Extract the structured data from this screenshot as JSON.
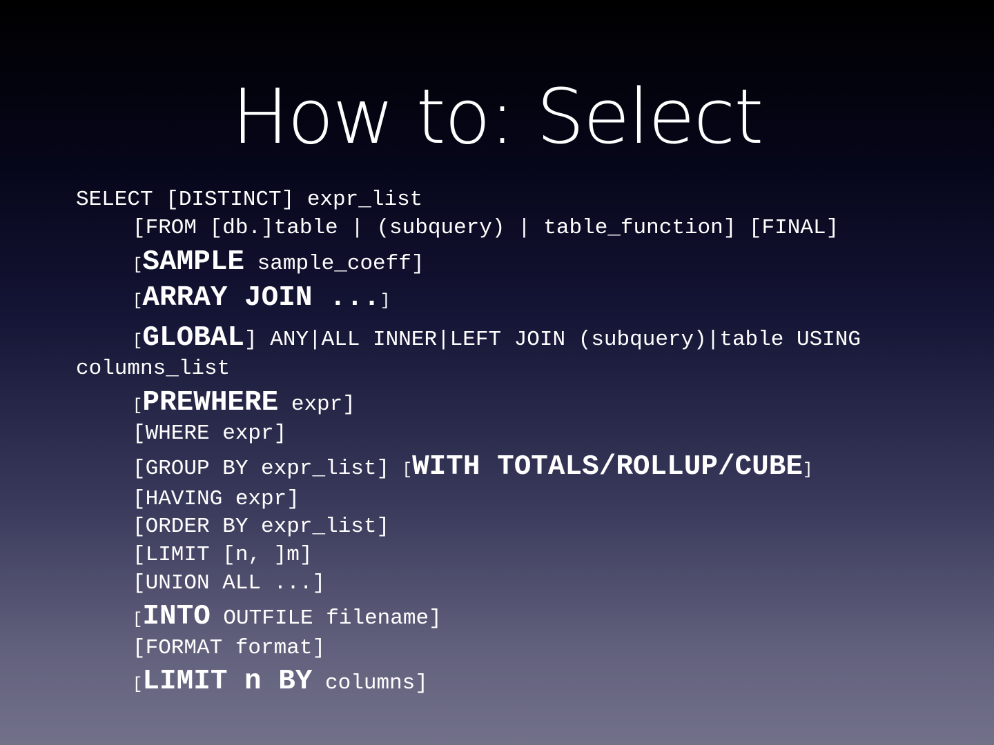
{
  "title": "How to: Select",
  "lines": {
    "l1": {
      "text": "SELECT [DISTINCT] expr_list"
    },
    "l2": {
      "text": "[FROM [db.]table | (subquery) | table_function] [FINAL]"
    },
    "l3": {
      "open": "[",
      "keyword": "SAMPLE",
      "rest": " sample_coeff]"
    },
    "l4": {
      "open": "[",
      "keyword": "ARRAY JOIN ...",
      "close": "]"
    },
    "l5": {
      "open": "[",
      "keyword": "GLOBAL",
      "rest": "] ANY|ALL INNER|LEFT JOIN (subquery)|table USING"
    },
    "l6": {
      "text": "columns_list"
    },
    "l7": {
      "open": "[",
      "keyword": "PREWHERE",
      "rest": " expr]"
    },
    "l8": {
      "text": "[WHERE expr]"
    },
    "l9": {
      "text": "[GROUP BY expr_list] ",
      "open": "[",
      "keyword": "WITH TOTALS/ROLLUP/CUBE",
      "close": "]"
    },
    "l10": {
      "text": "[HAVING expr]"
    },
    "l11": {
      "text": "[ORDER BY expr_list]"
    },
    "l12": {
      "text": "[LIMIT [n, ]m]"
    },
    "l13": {
      "text": "[UNION ALL ...]"
    },
    "l14": {
      "open": "[",
      "keyword": "INTO",
      "rest": " OUTFILE filename]"
    },
    "l15": {
      "text": "[FORMAT format]"
    },
    "l16": {
      "open": "[",
      "keyword": "LIMIT n BY",
      "rest": " columns]"
    }
  }
}
